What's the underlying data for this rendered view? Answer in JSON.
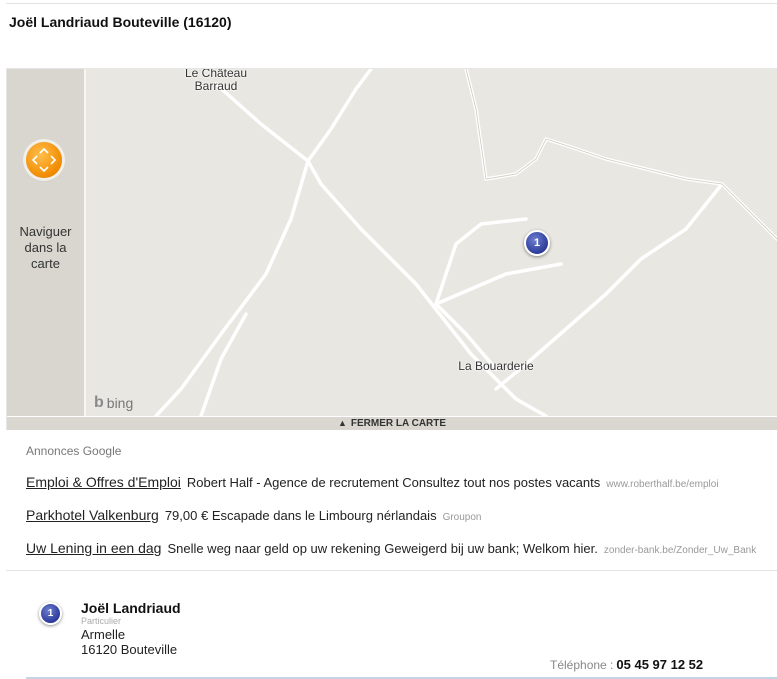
{
  "title": "Joël Landriaud Bouteville (16120)",
  "map": {
    "nav_label_lines": [
      "Naviguer",
      "dans la",
      "carte"
    ],
    "places": {
      "chateau_line1": "Le Château",
      "chateau_line2": "Barraud",
      "bouarderie": "La Bouarderie"
    },
    "bing_logo": "bing",
    "pin_number": "1",
    "close_label": "FERMER LA CARTE"
  },
  "ads": {
    "label": "Annonces Google",
    "items": [
      {
        "title": "Emploi & Offres d'Emploi",
        "desc": "Robert Half - Agence de recrutement Consultez tout nos postes vacants",
        "url": "www.roberthalf.be/emploi"
      },
      {
        "title": "Parkhotel Valkenburg",
        "desc": "79,00 € Escapade dans le Limbourg nérlandais",
        "url": "Groupon"
      },
      {
        "title": "Uw Lening in een dag",
        "desc": "Snelle weg naar geld op uw rekening Geweigerd bij uw bank; Welkom hier.",
        "url": "zonder-bank.be/Zonder_Uw_Bank"
      }
    ]
  },
  "result": {
    "number": "1",
    "name": "Joël Landriaud",
    "type": "Particulier",
    "line1": "Armelle",
    "line2": "16120 Bouteville",
    "phone_label": "Téléphone :",
    "phone": "05 45 97 12 52"
  },
  "icons": {
    "nav": "pan-arrows-icon",
    "pin": "map-marker-icon",
    "bing": "bing-logo-icon"
  }
}
